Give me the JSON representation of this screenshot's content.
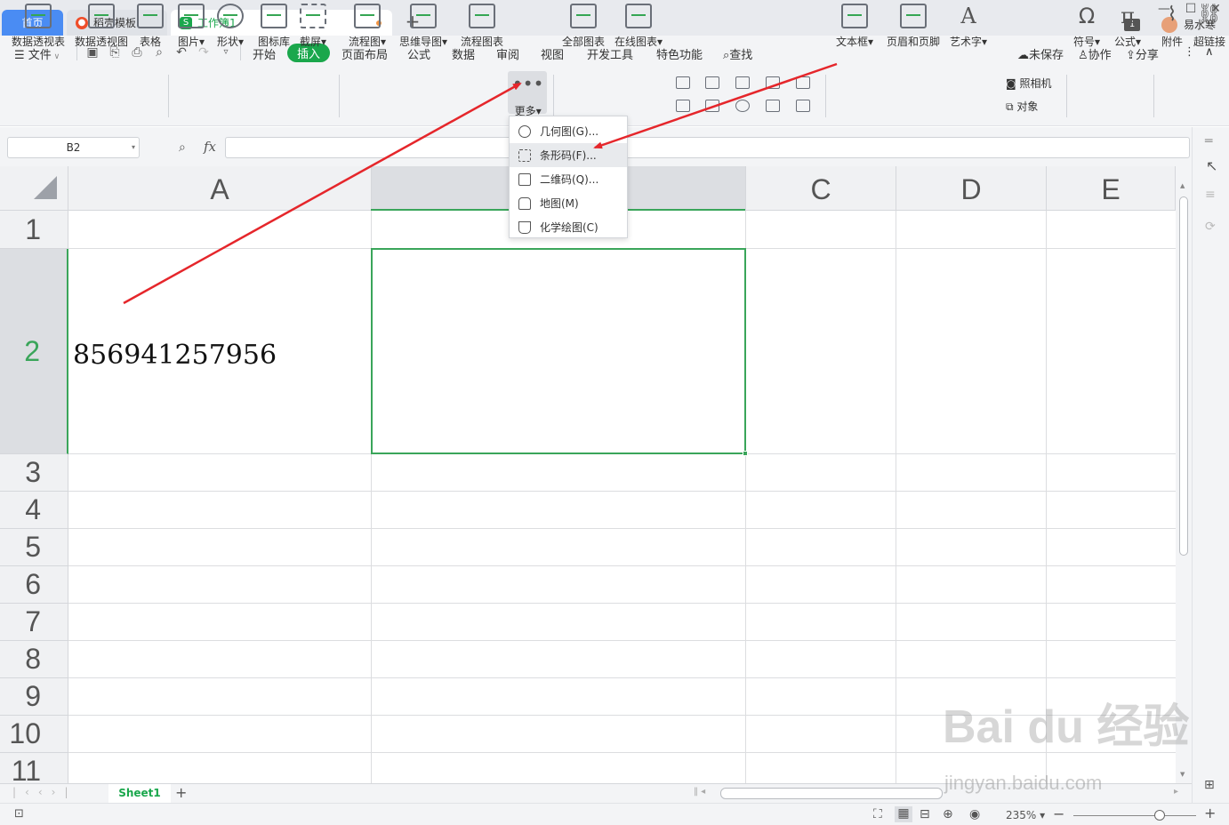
{
  "titlebar": {
    "tabs": [
      {
        "label": "首页"
      },
      {
        "label": "稻壳模板"
      },
      {
        "label": "工作簿1"
      }
    ],
    "user_name": "易水寒",
    "window_count": "1"
  },
  "menu": {
    "file": "文件",
    "items": [
      "开始",
      "插入",
      "页面布局",
      "公式",
      "数据",
      "审阅",
      "视图",
      "开发工具",
      "特色功能"
    ],
    "search": "查找",
    "unsaved": "未保存",
    "collab": "协作",
    "share": "分享"
  },
  "ribbon": {
    "pivot_table": "数据透视表",
    "pivot_chart": "数据透视图",
    "table": "表格",
    "picture": "图片",
    "shape": "形状",
    "icon_lib": "图标库",
    "screenshot": "截屏",
    "flowchart": "流程图",
    "mindmap": "思维导图",
    "smart_chart": "流程图表",
    "more": "更多",
    "all_charts": "全部图表",
    "online_charts": "在线图表",
    "textbox": "文本框",
    "header_footer": "页眉和页脚",
    "word_art": "艺术字",
    "camera": "照相机",
    "object": "对象",
    "symbol": "符号",
    "formula": "公式",
    "attachment": "附件",
    "hyperlink": "超链接"
  },
  "formula_bar": {
    "name_box": "B2",
    "fx": "fx",
    "value": ""
  },
  "grid": {
    "columns": [
      "A",
      "",
      "C",
      "D",
      "E"
    ],
    "rows": [
      "1",
      "2",
      "3",
      "4",
      "5",
      "6",
      "7",
      "8",
      "9",
      "10",
      "11"
    ],
    "cell_a2": "856941257956",
    "selected_cell": "B2"
  },
  "dropdown": {
    "items": [
      {
        "label": "几何图(G)..."
      },
      {
        "label": "条形码(F)..."
      },
      {
        "label": "二维码(Q)..."
      },
      {
        "label": "地图(M)"
      },
      {
        "label": "化学绘图(C)"
      }
    ],
    "hovered_index": 1
  },
  "sheets": {
    "active": "Sheet1"
  },
  "status": {
    "zoom": "235%"
  },
  "watermark": {
    "line1": "Bai du 经验",
    "line2": "jingyan.baidu.com"
  },
  "colors": {
    "accent_green": "#1aa74c",
    "home_tab_blue": "#4a8cf3",
    "annotation_red": "#e5262b"
  }
}
